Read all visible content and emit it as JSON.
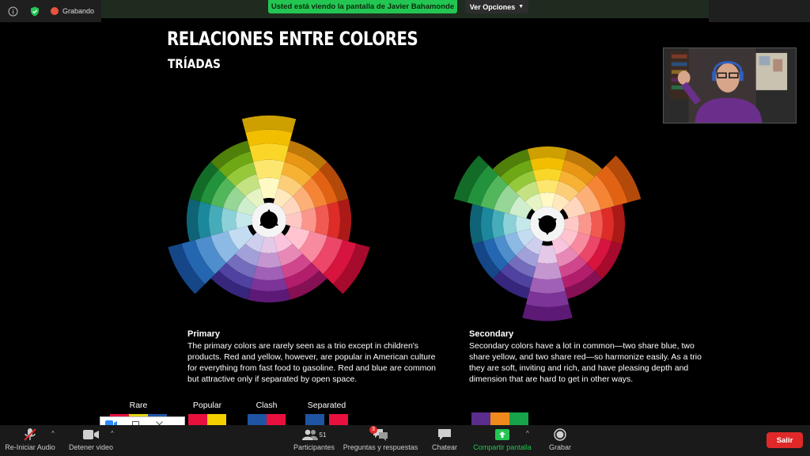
{
  "top_bar": {
    "recording_label": "Grabando",
    "share_banner": "Usted está viendo la pantalla de Javier Bahamonde",
    "view_options": "Ver Opciones",
    "view_options_icon": "chevron-down-icon"
  },
  "slide": {
    "title": "RELACIONES ENTRE COLORES",
    "subtitle": "TRÍADAS",
    "primary": {
      "title": "Primary",
      "body": "The primary colors are rarely seen as a trio except in children's products. Red and yellow, however, are popular in American culture for everything from fast food to gasoline. Red and blue are common but attractive only if separated by open space."
    },
    "secondary": {
      "title": "Secondary",
      "body": "Secondary colors have a lot in common—two share blue, two share yellow, and two share red—so harmonize easily. As a trio they are soft, inviting and rich, and have pleasing depth and dimension that are hard to get in other ways."
    },
    "swatches": [
      {
        "label": "Rare",
        "colors": [
          "#e8113e",
          "#e4d416",
          "#1f54a3"
        ]
      },
      {
        "label": "Popular",
        "colors": [
          "#e8113e",
          "#f4d000"
        ]
      },
      {
        "label": "Clash",
        "colors": [
          "#1f54a3",
          "#e8113e"
        ]
      },
      {
        "label": "Separated",
        "colors": [
          "#1f54a3",
          "#e8113e"
        ]
      }
    ],
    "secondary_swatch_colors": [
      "#5b2d8c",
      "#f08a1c",
      "#16a34a"
    ]
  },
  "toolbar": {
    "audio_label": "Re-Iniciar Audio",
    "video_label": "Detener video",
    "participants_label": "Participantes",
    "participants_count": "51",
    "qa_label": "Preguntas y respuestas",
    "qa_badge": "3",
    "chat_label": "Chatear",
    "share_label": "Compartir pantalla",
    "record_label": "Grabar",
    "leave_label": "Salir"
  },
  "colors": {
    "banner_green": "#23c553",
    "leave_red": "#e02828"
  }
}
